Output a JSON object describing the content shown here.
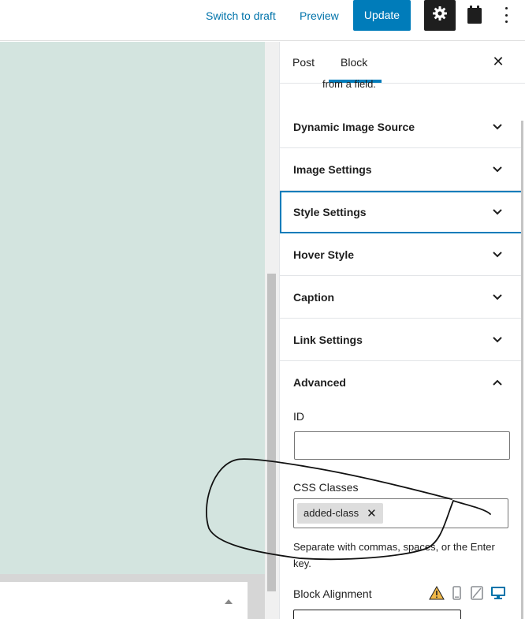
{
  "topbar": {
    "switch_to_draft": "Switch to draft",
    "preview": "Preview",
    "update": "Update",
    "settings_icon": "gear-icon",
    "calendar_icon": "calendar-icon",
    "more_icon": "more-vertical-icon"
  },
  "sidebar": {
    "tabs": [
      {
        "label": "Post"
      },
      {
        "label": "Block",
        "active": true
      }
    ],
    "close_icon": "close-icon",
    "close_glyph": "✕",
    "cut_off_text": "from a field.",
    "panels": [
      {
        "title": "Dynamic Image Source",
        "expanded": false
      },
      {
        "title": "Image Settings",
        "expanded": false
      },
      {
        "title": "Style Settings",
        "expanded": false,
        "focused": true
      },
      {
        "title": "Hover Style",
        "expanded": false
      },
      {
        "title": "Caption",
        "expanded": false
      },
      {
        "title": "Link Settings",
        "expanded": false
      },
      {
        "title": "Advanced",
        "expanded": true
      }
    ],
    "advanced": {
      "id_label": "ID",
      "id_value": "",
      "css_classes_label": "CSS Classes",
      "css_token": "added-class",
      "token_remove_glyph": "✕",
      "help_text": "Separate with commas, spaces, or the Enter key.",
      "block_alignment_label": "Block Alignment",
      "alignment_icons": [
        "warning-icon",
        "mobile-icon",
        "tablet-icon",
        "desktop-icon"
      ]
    }
  },
  "colors": {
    "accent": "#007cba",
    "canvas": "#d3e4df",
    "warning": "#f0b849"
  }
}
